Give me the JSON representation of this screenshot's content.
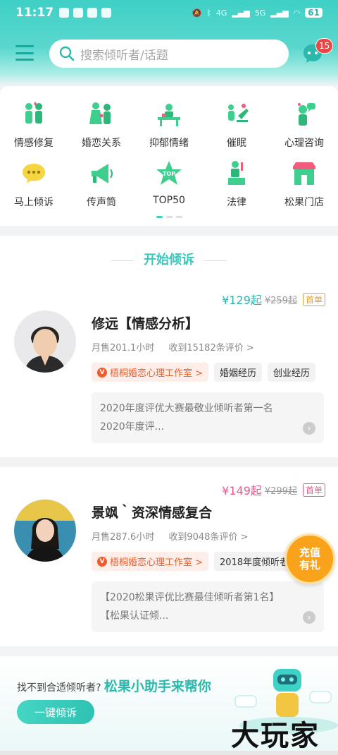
{
  "status": {
    "time": "11:17",
    "network_a": "4G",
    "network_b": "5G",
    "battery": "61"
  },
  "header": {
    "search_placeholder": "搜索倾听者/话题",
    "message_count": "15"
  },
  "categories": [
    {
      "label": "情感修复",
      "icon": "couple-icon"
    },
    {
      "label": "婚恋关系",
      "icon": "marriage-icon"
    },
    {
      "label": "抑郁情绪",
      "icon": "desk-icon"
    },
    {
      "label": "催眠",
      "icon": "hypnosis-icon"
    },
    {
      "label": "心理咨询",
      "icon": "counsel-icon"
    },
    {
      "label": "马上倾诉",
      "icon": "chat-bubble-icon"
    },
    {
      "label": "传声筒",
      "icon": "megaphone-icon"
    },
    {
      "label": "TOP50",
      "icon": "top-star-icon"
    },
    {
      "label": "法律",
      "icon": "law-icon"
    },
    {
      "label": "松果门店",
      "icon": "store-icon"
    }
  ],
  "section_title": "开始倾诉",
  "listeners": [
    {
      "price": "¥129起",
      "old_price": "¥259起",
      "tag": "首单",
      "name": "修远【情感分析】",
      "sold": "月售201.1小时",
      "reviews": "收到15182条评价 >",
      "studio": "梧桐婚恋心理工作室 >",
      "chips": [
        "婚姻经历",
        "创业经历"
      ],
      "honor": [
        "2020年度评优大赛最敬业倾听者第一名",
        "2020年度评..."
      ]
    },
    {
      "price": "¥149起",
      "old_price": "¥299起",
      "tag": "首单",
      "name": "景飒｀资深情感复合",
      "sold": "月售287.6小时",
      "reviews": "收到9048条评价 >",
      "studio": "梧桐婚恋心理工作室 >",
      "chips": [
        "2018年度倾听者"
      ],
      "honor": [
        "【2020松果评优比赛最佳倾听者第1名】",
        "【松果认证倾..."
      ]
    }
  ],
  "recharge": {
    "line1": "充值",
    "line2": "有礼"
  },
  "helper": {
    "question": "找不到合适倾听者?",
    "highlight": "松果小助手来帮你",
    "button": "一键倾诉"
  },
  "watermark": "大玩家",
  "colors": {
    "accent": "#3fd0c6",
    "price1": "#2bb8ad",
    "price2": "#e85a8a",
    "studio": "#e8602c"
  }
}
